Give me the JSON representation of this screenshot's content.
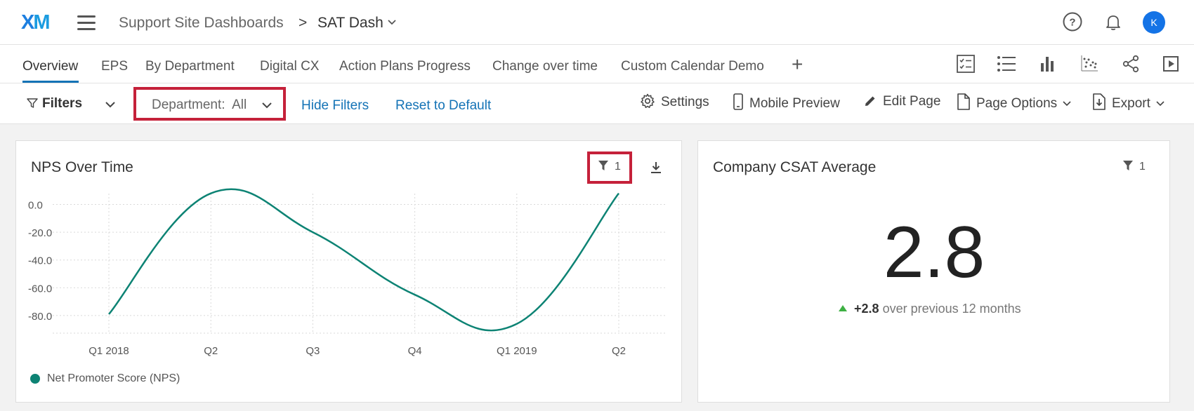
{
  "header": {
    "logo": {
      "x": "X",
      "m": "M"
    },
    "breadcrumb_root": "Support Site Dashboards",
    "breadcrumb_sep": ">",
    "dashboard_name": "SAT Dash",
    "avatar_initial": "K",
    "icons": [
      "menu-icon",
      "help-icon",
      "bell-icon",
      "chevron-down-icon"
    ]
  },
  "tabs": {
    "items": [
      {
        "label": "Overview",
        "active": true
      },
      {
        "label": "EPS"
      },
      {
        "label": "By Department"
      },
      {
        "label": "Digital CX"
      },
      {
        "label": "Action Plans Progress"
      },
      {
        "label": "Change over time"
      },
      {
        "label": "Custom Calendar Demo"
      }
    ],
    "add_label": "+",
    "view_icons": [
      "checklist-icon",
      "list-icon",
      "bar-chart-icon",
      "scatter-icon",
      "share-icon",
      "present-icon"
    ]
  },
  "filterbar": {
    "filters_label": "Filters",
    "department_label": "Department:",
    "department_value": "All",
    "hide_filters": "Hide Filters",
    "reset_default": "Reset to Default",
    "settings": "Settings",
    "mobile_preview": "Mobile Preview",
    "edit_page": "Edit Page",
    "page_options": "Page Options",
    "export": "Export"
  },
  "widgets": {
    "nps": {
      "title": "NPS Over Time",
      "filter_count": "1",
      "legend": "Net Promoter Score (NPS)",
      "color": "#0d8374"
    },
    "csat": {
      "title": "Company CSAT Average",
      "filter_count": "1",
      "value": "2.8",
      "delta_value": "+2.8",
      "delta_text": "over previous 12 months",
      "delta_color": "#3db043"
    }
  },
  "chart_data": {
    "type": "line",
    "title": "NPS Over Time",
    "categories": [
      "Q1 2018",
      "Q2",
      "Q3",
      "Q4",
      "Q1 2019",
      "Q2"
    ],
    "series": [
      {
        "name": "Net Promoter Score (NPS)",
        "values": [
          -79,
          8,
          -20,
          -65,
          -86,
          8
        ]
      }
    ],
    "yticks": [
      "0.0",
      "-20.0",
      "-40.0",
      "-60.0",
      "-80.0"
    ],
    "ylim": [
      -90,
      8
    ],
    "grid": true,
    "legend": "bottom-left"
  }
}
